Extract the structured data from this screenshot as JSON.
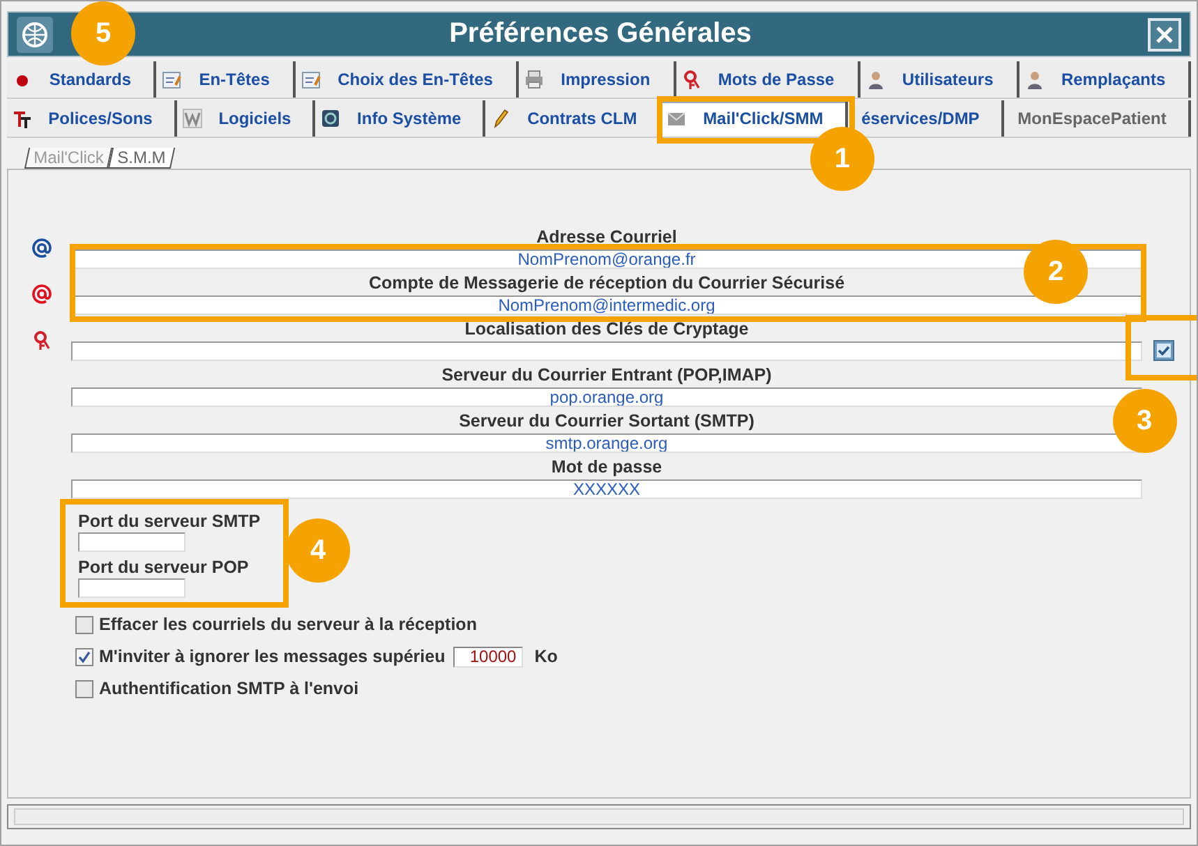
{
  "window": {
    "title": "Préférences Générales"
  },
  "tab_rows": [
    [
      {
        "label": "Standards",
        "selected": false,
        "disabled": false
      },
      {
        "label": "En-Têtes",
        "selected": false,
        "disabled": false
      },
      {
        "label": "Choix des En-Têtes",
        "selected": false,
        "disabled": false
      },
      {
        "label": "Impression",
        "selected": false,
        "disabled": false
      },
      {
        "label": "Mots de Passe",
        "selected": false,
        "disabled": false
      },
      {
        "label": "Utilisateurs",
        "selected": false,
        "disabled": false
      },
      {
        "label": "Remplaçants",
        "selected": false,
        "disabled": false
      }
    ],
    [
      {
        "label": "Polices/Sons",
        "selected": false,
        "disabled": false
      },
      {
        "label": "Logiciels",
        "selected": false,
        "disabled": false
      },
      {
        "label": "Info Système",
        "selected": false,
        "disabled": false
      },
      {
        "label": "Contrats CLM",
        "selected": false,
        "disabled": false
      },
      {
        "label": "Mail'Click/SMM",
        "selected": true,
        "disabled": false
      },
      {
        "label": "éservices/DMP",
        "selected": false,
        "disabled": false
      },
      {
        "label": "MonEspacePatient",
        "selected": false,
        "disabled": true
      }
    ]
  ],
  "subtabs": [
    {
      "label": "Mail'Click",
      "selected": false
    },
    {
      "label": "S.M.M",
      "selected": true
    }
  ],
  "fields": [
    {
      "kind": "text",
      "label": "Adresse Courriel",
      "value": "NomPrenom@orange.fr"
    },
    {
      "kind": "text",
      "label": "Compte de Messagerie de réception du Courrier Sécurisé",
      "value": "NomPrenom@intermedic.org"
    },
    {
      "kind": "browse",
      "label": "Localisation des Clés de Cryptage"
    },
    {
      "kind": "text",
      "label": "Serveur du Courrier Entrant (POP,IMAP)",
      "value": "pop.orange.org"
    },
    {
      "kind": "text",
      "label": "Serveur du Courrier Sortant (SMTP)",
      "value": "smtp.orange.org"
    },
    {
      "kind": "text",
      "label": "Mot de passe",
      "value": "XXXXXX"
    }
  ],
  "ports": [
    {
      "label": "Port du serveur SMTP"
    },
    {
      "label": "Port du serveur POP"
    }
  ],
  "options": [
    {
      "kind": "plain",
      "label": "Effacer les courriels du serveur à la réception",
      "checked": false
    },
    {
      "kind": "number",
      "label": "M'inviter à ignorer les messages supérieu",
      "checked": true,
      "value": "10000",
      "unit": "Ko"
    },
    {
      "kind": "plain",
      "label": "Authentification SMTP à l'envoi",
      "checked": false
    }
  ],
  "callouts": [
    {
      "number": "5"
    },
    {
      "number": "1"
    },
    {
      "number": "2"
    },
    {
      "number": "3"
    },
    {
      "number": "4"
    }
  ]
}
